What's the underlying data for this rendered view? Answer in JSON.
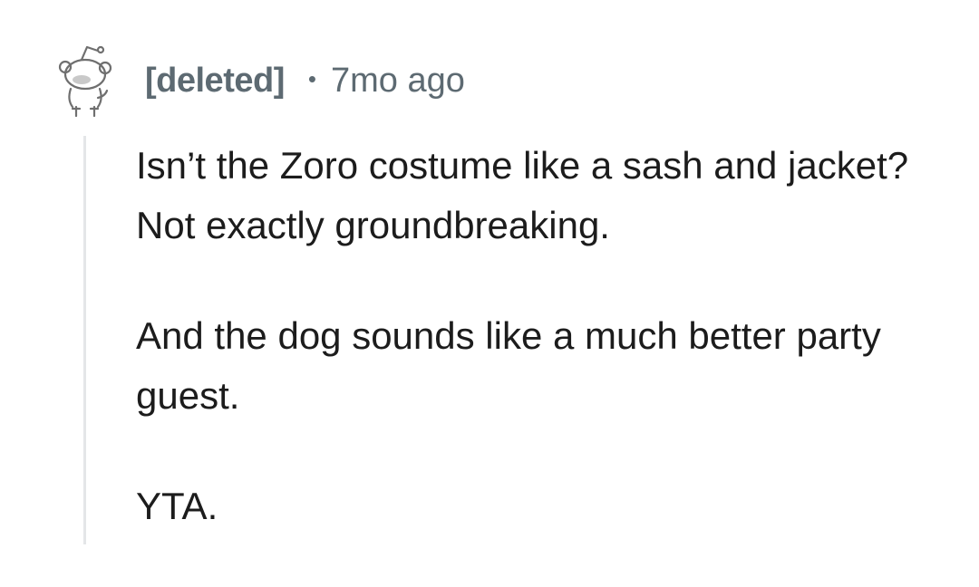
{
  "comment": {
    "author": "[deleted]",
    "separator": "•",
    "timestamp": "7mo ago",
    "paragraphs": [
      "Isn’t the Zoro costume like a sash and jacket? Not exactly groundbreaking.",
      "And the dog sounds like a much better party guest.",
      "YTA."
    ],
    "avatar_icon": "deleted-user-snoo-icon",
    "text_color": "#1c1c1c",
    "meta_color": "#5d6a72",
    "thread_line_color": "#e4e6e8"
  }
}
